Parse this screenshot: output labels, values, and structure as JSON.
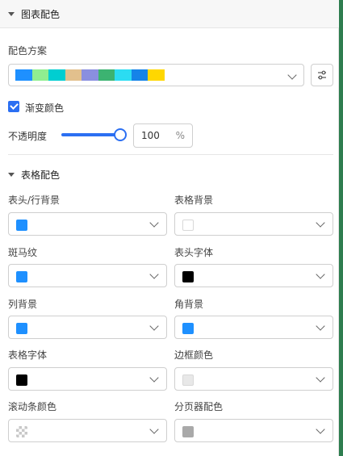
{
  "section": {
    "title": "图表配色"
  },
  "scheme": {
    "label": "配色方案",
    "colors": [
      "#1e90ff",
      "#90ee90",
      "#00ced1",
      "#e2c08d",
      "#8a8fe0",
      "#3cb371",
      "#2bdcf2",
      "#1583e8",
      "#ffd700"
    ]
  },
  "gradient": {
    "label": "渐变颜色",
    "checked": true
  },
  "opacity": {
    "label": "不透明度",
    "value": "100",
    "unit": "%",
    "level": 1.0
  },
  "table": {
    "title": "表格配色",
    "fields": [
      {
        "label": "表头/行背景",
        "color": "#1e90ff"
      },
      {
        "label": "表格背景",
        "color": "#ffffff"
      },
      {
        "label": "斑马纹",
        "color": "#1e90ff"
      },
      {
        "label": "表头字体",
        "color": "#000000"
      },
      {
        "label": "列背景",
        "color": "#1e90ff"
      },
      {
        "label": "角背景",
        "color": "#1e90ff"
      },
      {
        "label": "表格字体",
        "color": "#000000"
      },
      {
        "label": "边框颜色",
        "color": "#e8e8e8"
      },
      {
        "label": "滚动条颜色",
        "color": "checkered"
      },
      {
        "label": "分页器配色",
        "color": "#a9a9a9"
      }
    ]
  },
  "icons": {
    "section_caret": "caret-down-icon",
    "select_chevron": "chevron-down-icon",
    "settings": "sliders-settings-icon",
    "checkbox": "check-icon"
  }
}
